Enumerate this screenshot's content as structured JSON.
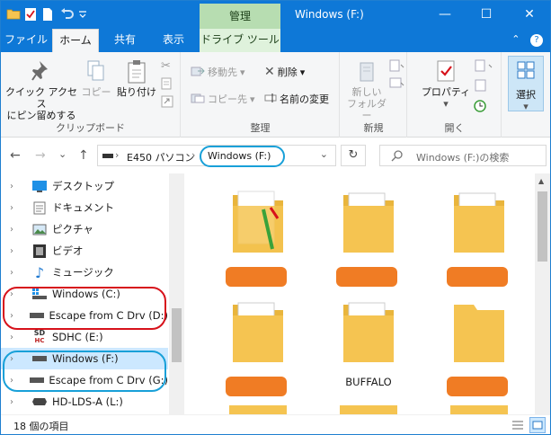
{
  "titlebar": {
    "context_tab": "管理",
    "title": "Windows (F:)",
    "minimize": "—",
    "maximize": "☐",
    "close": "✕"
  },
  "tabs": {
    "file": "ファイル",
    "home": "ホーム",
    "share": "共有",
    "view": "表示",
    "drive_tools": "ドライブ ツール",
    "collapse": "⌃",
    "help": "?"
  },
  "ribbon": {
    "clipboard": {
      "pin_label_1": "クイック アクセス",
      "pin_label_2": "にピン留めする",
      "copy": "コピー",
      "paste": "貼り付け",
      "group": "クリップボード"
    },
    "organize": {
      "move_to": "移動先",
      "copy_to": "コピー先",
      "delete": "削除",
      "rename": "名前の変更",
      "group": "整理"
    },
    "new": {
      "new_folder_1": "新しい",
      "new_folder_2": "フォルダー",
      "group": "新規"
    },
    "open": {
      "properties": "プロパティ",
      "group": "開く"
    },
    "select": {
      "label": "選択"
    }
  },
  "address": {
    "back": "←",
    "forward": "→",
    "recent": "⌄",
    "up": "↑",
    "pc": "E450 パソコン",
    "separator": "›",
    "drive": "Windows (F:)",
    "dropdown": "⌄",
    "refresh": "↻",
    "search_placeholder": "Windows (F:)の検索"
  },
  "nav": {
    "items": [
      {
        "label": "デスクトップ",
        "icon": "desktop-icon"
      },
      {
        "label": "ドキュメント",
        "icon": "documents-icon"
      },
      {
        "label": "ピクチャ",
        "icon": "pictures-icon"
      },
      {
        "label": "ビデオ",
        "icon": "videos-icon"
      },
      {
        "label": "ミュージック",
        "icon": "music-icon"
      },
      {
        "label": "Windows (C:)",
        "icon": "windows-drive-icon"
      },
      {
        "label": "Escape from C Drv (D:)",
        "icon": "drive-icon"
      },
      {
        "label": "SDHC (E:)",
        "icon": "sd-card-icon"
      },
      {
        "label": "Windows (F:)",
        "icon": "drive-icon"
      },
      {
        "label": "Escape from C Drv (G:)",
        "icon": "drive-icon"
      },
      {
        "label": "HD-LDS-A (L:)",
        "icon": "optical-drive-icon"
      }
    ],
    "chevron": "›",
    "sd_badge": "SD",
    "sd_sub": "HC"
  },
  "content": {
    "tiles": [
      {
        "label": "",
        "redacted": true
      },
      {
        "label": "",
        "redacted": true
      },
      {
        "label": "",
        "redacted": true
      },
      {
        "label": "",
        "redacted": true
      },
      {
        "label": "BUFFALO",
        "redacted": false
      },
      {
        "label": "",
        "redacted": true
      }
    ]
  },
  "status": {
    "count": "18 個の項目"
  },
  "colors": {
    "accent": "#0e78d7",
    "selection": "#cce8ff",
    "folder": "#f5c451",
    "redaction": "#f07c24",
    "annotation_red": "#d7121b",
    "annotation_blue": "#18a0d8"
  }
}
